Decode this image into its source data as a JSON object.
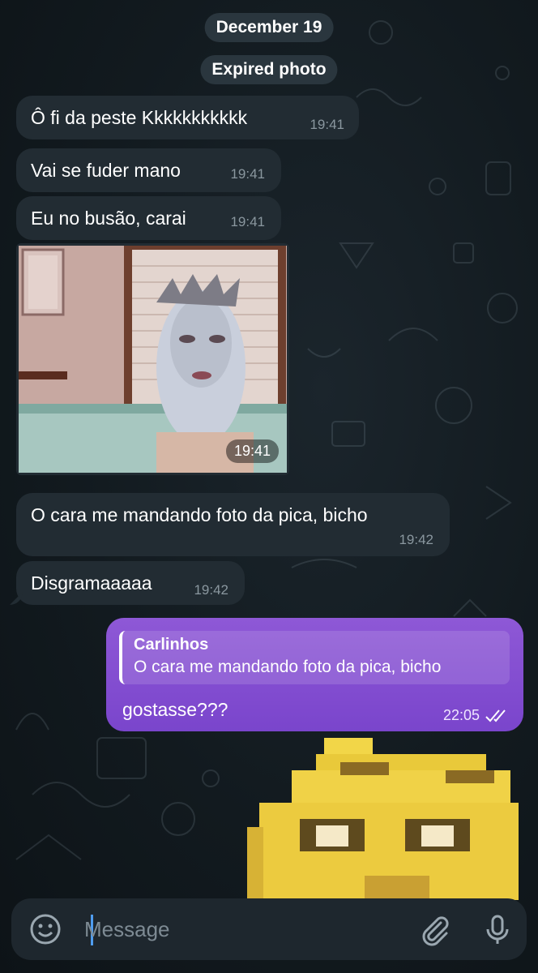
{
  "date_pill": "December 19",
  "system_pill": "Expired photo",
  "messages_in": [
    {
      "text": "Ô fi da peste Kkkkkkkkkkk",
      "time": "19:41"
    },
    {
      "text": "Vai se fuder mano",
      "time": "19:41"
    },
    {
      "text": "Eu no busão, carai",
      "time": "19:41"
    }
  ],
  "photo": {
    "time": "19:41"
  },
  "messages_in_2": [
    {
      "text": "O cara me mandando foto da pica, bicho",
      "time": "19:42"
    },
    {
      "text": "Disgramaaaaa",
      "time": "19:42"
    }
  ],
  "outgoing": {
    "reply_name": "Carlinhos",
    "reply_text": "O cara me mandando foto da pica, bicho",
    "text": "gostasse???",
    "time": "22:05",
    "status": "read-double-check-icon"
  },
  "input": {
    "placeholder": "Message"
  },
  "icons": {
    "emoji": "smiley-icon",
    "attach": "paperclip-icon",
    "mic": "microphone-icon"
  },
  "colors": {
    "incoming_bubble": "#222c33",
    "outgoing_bubble": "#7a45cc",
    "background": "#0f1519",
    "pill": "#2a363e"
  }
}
